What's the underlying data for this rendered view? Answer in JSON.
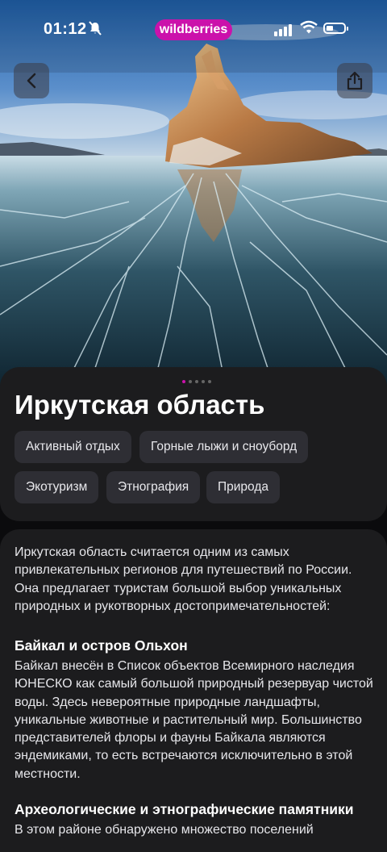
{
  "status_bar": {
    "time": "01:12",
    "brand": "wildberries"
  },
  "colors": {
    "accent": "#cb11ab",
    "card_bg": "#1c1c1e",
    "chip_bg": "#2e2e34"
  },
  "icons": {
    "back": "chevron-left-icon",
    "share": "share-icon"
  },
  "carousel": {
    "pages": 5,
    "current": 1
  },
  "region": {
    "title": "Иркутская область",
    "tags": [
      "Активный отдых",
      "Горные лыжи и сноуборд",
      "Экотуризм",
      "Этнография",
      "Природа"
    ]
  },
  "article": {
    "intro": "Иркутская область считается одним из самых привлекательных регионов для путешествий по России. Она предлагает туристам большой выбор уникальных природных и рукотворных достопримечательностей:",
    "sections": [
      {
        "heading": "Байкал и остров Ольхон",
        "text": "Байкал внесён в Список объектов Всемирного наследия ЮНЕСКО как самый большой природный резервуар чистой воды. Здесь невероятные природные ландшафты, уникальные животные и растительный мир. Большинство представителей флоры и фауны Байкала являются эндемиками, то есть встречаются исключительно в этой местности."
      },
      {
        "heading": "Археологические и этнографические памятники",
        "text": "В этом районе обнаружено множество поселений"
      }
    ]
  }
}
